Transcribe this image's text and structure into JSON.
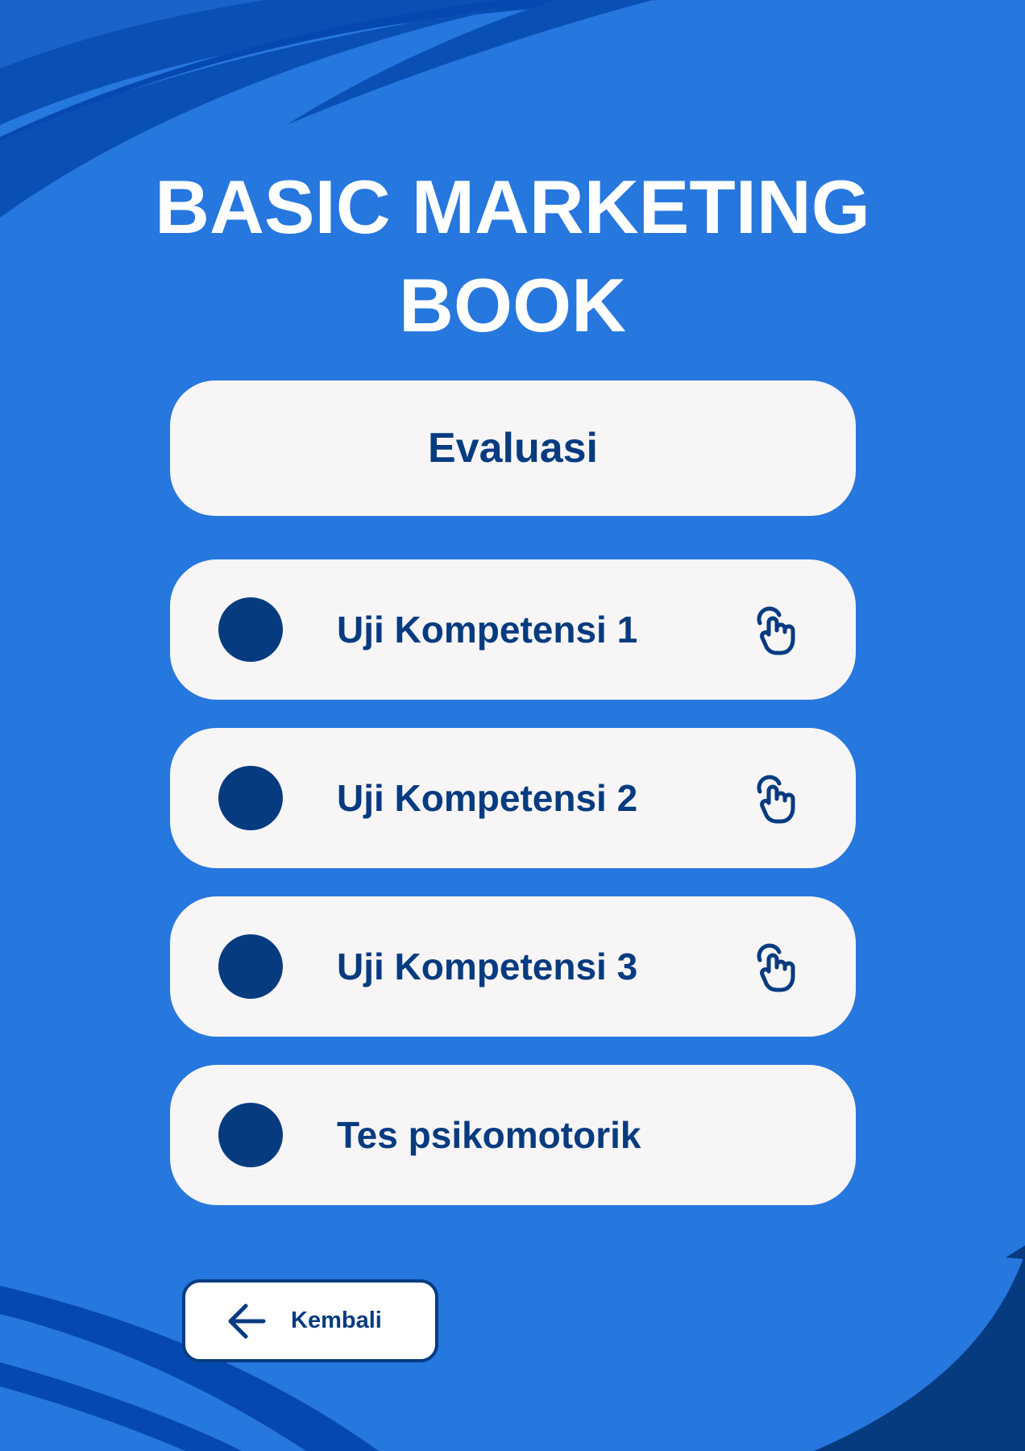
{
  "title": {
    "line1": "BASIC MARKETING",
    "line2": "BOOK"
  },
  "header": {
    "label": "Evaluasi"
  },
  "menu": {
    "items": [
      {
        "label": "Uji Kompetensi 1",
        "icon": "tap-hand-icon"
      },
      {
        "label": "Uji Kompetensi 2",
        "icon": "tap-hand-icon"
      },
      {
        "label": "Uji Kompetensi 3",
        "icon": "tap-hand-icon"
      },
      {
        "label": "Tes psikomotorik",
        "icon": ""
      }
    ]
  },
  "back_button": {
    "label": "Kembali",
    "icon": "arrow-left-icon"
  },
  "colors": {
    "background": "#2677de",
    "dark_blue": "#063b80",
    "deco_blue": "#0a4fb3",
    "card": "#f7f5f6"
  }
}
